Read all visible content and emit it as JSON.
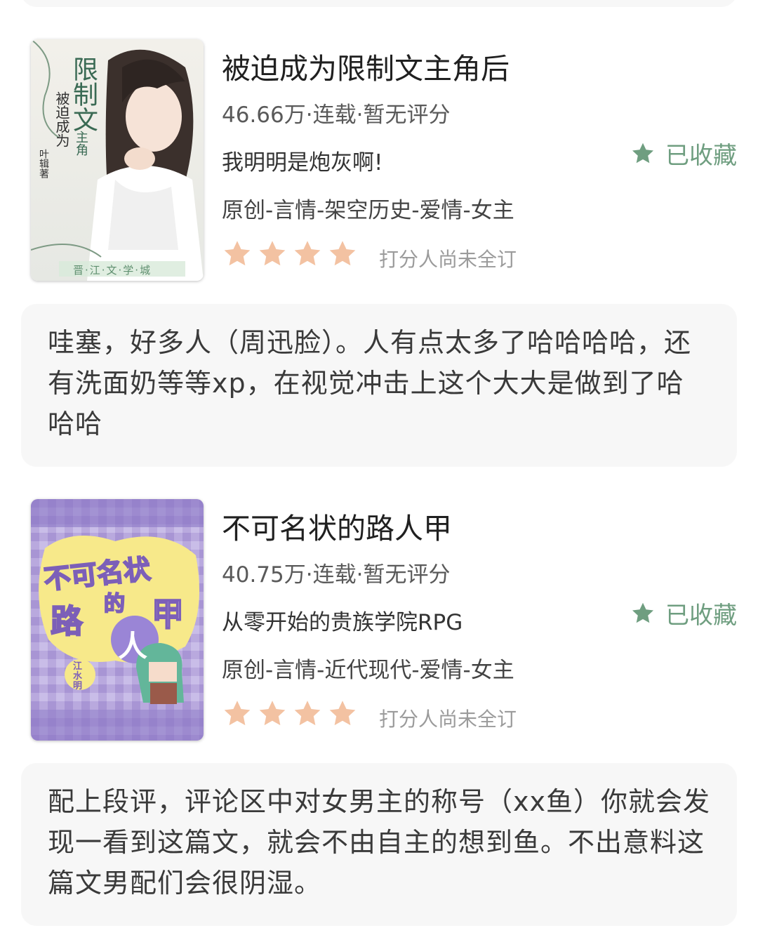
{
  "books": [
    {
      "title": "被迫成为限制文主角后",
      "meta": "46.66万·连载·暂无评分",
      "intro": "我明明是炮灰啊!",
      "tags": "原创-言情-架空历史-爱情-女主",
      "stars": 4,
      "rating_note": "打分人尚未全订",
      "favorite_label": "已收藏",
      "cover_text": {
        "big": "限制文",
        "small": "主角",
        "line": "被迫成为",
        "author": "叶辑著",
        "footer": "晋·江·文·学·城"
      }
    },
    {
      "title": "不可名状的路人甲",
      "meta": "40.75万·连载·暂无评分",
      "intro": "从零开始的贵族学院RPG",
      "tags": "原创-言情-近代现代-爱情-女主",
      "stars": 4,
      "rating_note": "打分人尚未全订",
      "favorite_label": "已收藏",
      "cover_text": {
        "line1": "不可名状",
        "de": "的",
        "lu": "路",
        "ren": "人",
        "jia": "甲",
        "author": "江水明"
      }
    }
  ],
  "comments": [
    "哇塞，好多人（周迅脸）。人有点太多了哈哈哈哈，还有洗面奶等等xp，在视觉冲击上这个大大是做到了哈哈哈",
    "配上段评，评论区中对女男主的称号（xx鱼）你就会发现一看到这篇文，就会不由自主的想到鱼。不出意料这篇文男配们会很阴湿。"
  ],
  "colors": {
    "star": "#f3c2a2",
    "favorite": "#6f9e80",
    "card": "#f7f7f7"
  }
}
